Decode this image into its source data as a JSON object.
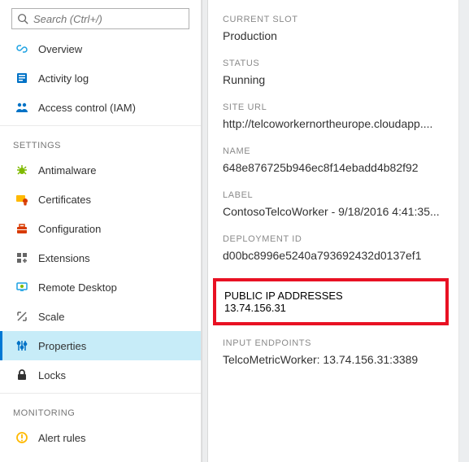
{
  "search": {
    "placeholder": "Search (Ctrl+/)"
  },
  "nav": {
    "top": [
      {
        "label": "Overview"
      },
      {
        "label": "Activity log"
      },
      {
        "label": "Access control (IAM)"
      }
    ],
    "settings_label": "SETTINGS",
    "settings": [
      {
        "label": "Antimalware"
      },
      {
        "label": "Certificates"
      },
      {
        "label": "Configuration"
      },
      {
        "label": "Extensions"
      },
      {
        "label": "Remote Desktop"
      },
      {
        "label": "Scale"
      },
      {
        "label": "Properties"
      },
      {
        "label": "Locks"
      }
    ],
    "monitoring_label": "MONITORING",
    "monitoring": [
      {
        "label": "Alert rules"
      }
    ]
  },
  "props": {
    "fields": [
      {
        "lbl": "CURRENT SLOT",
        "val": "Production"
      },
      {
        "lbl": "STATUS",
        "val": "Running"
      },
      {
        "lbl": "SITE URL",
        "val": "http://telcoworkernortheurope.cloudapp...."
      },
      {
        "lbl": "NAME",
        "val": "648e876725b946ec8f14ebadd4b82f92"
      },
      {
        "lbl": "LABEL",
        "val": "ContosoTelcoWorker - 9/18/2016 4:41:35..."
      },
      {
        "lbl": "DEPLOYMENT ID",
        "val": "d00bc8996e5240a793692432d0137ef1"
      }
    ],
    "highlight": {
      "lbl": "PUBLIC IP ADDRESSES",
      "val": "13.74.156.31"
    },
    "after": [
      {
        "lbl": "INPUT ENDPOINTS",
        "val": "TelcoMetricWorker: 13.74.156.31:3389"
      }
    ]
  }
}
